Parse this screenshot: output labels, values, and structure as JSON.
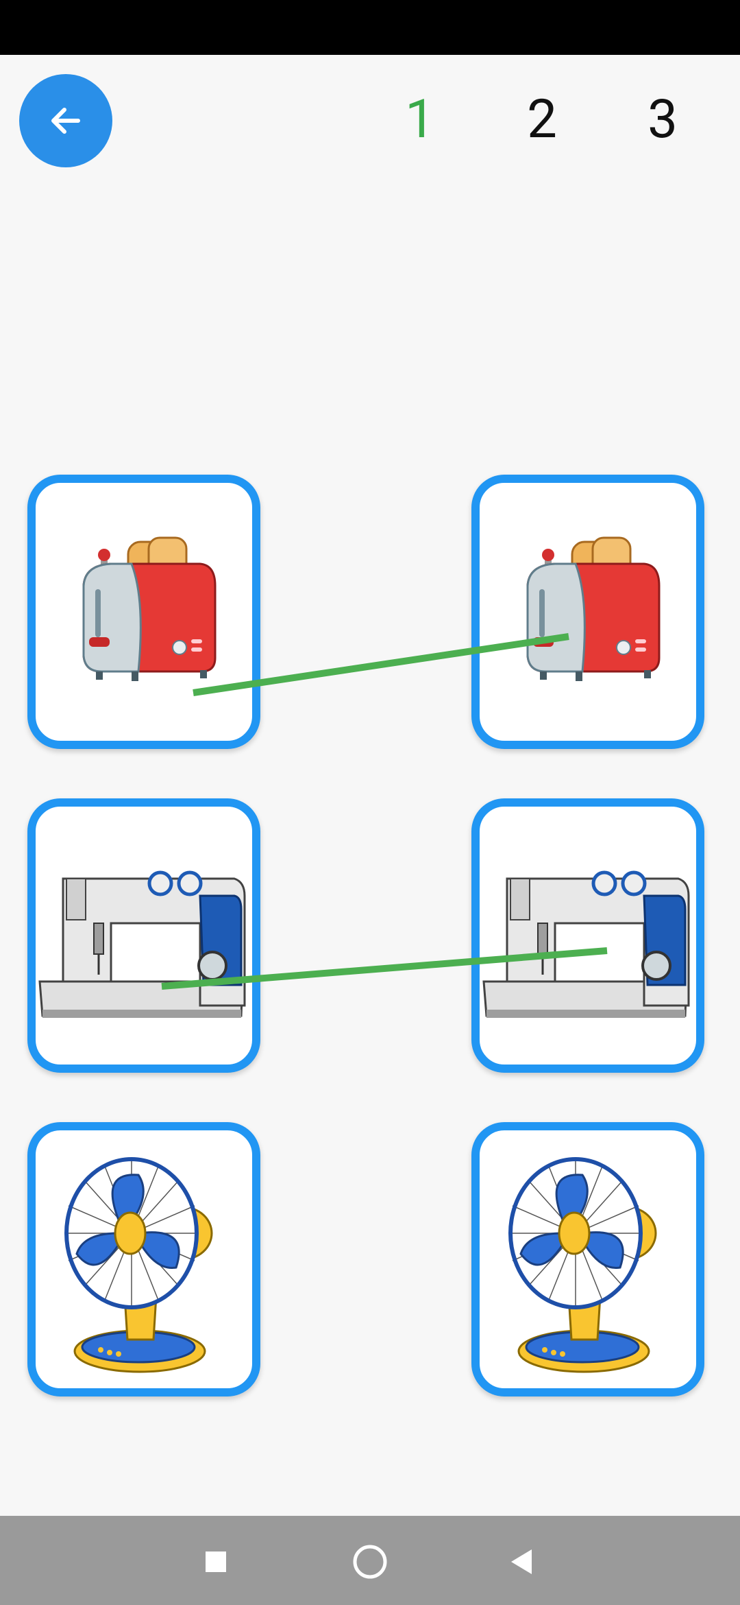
{
  "header": {
    "back_icon": "arrow-left-icon",
    "levels": [
      "1",
      "2",
      "3"
    ],
    "active_level": "1",
    "accent_color": "#2a8fe8",
    "active_level_color": "#3aaa4a"
  },
  "board": {
    "card_border_color": "#2196f3",
    "match_line_color": "#4caf50",
    "left_column": [
      {
        "item": "toaster-icon"
      },
      {
        "item": "sewing-machine-icon"
      },
      {
        "item": "electric-fan-icon"
      }
    ],
    "right_column": [
      {
        "item": "toaster-icon"
      },
      {
        "item": "sewing-machine-icon"
      },
      {
        "item": "electric-fan-icon"
      }
    ],
    "matches": [
      {
        "left": 0,
        "right": 0
      },
      {
        "left": 1,
        "right": 1
      }
    ]
  },
  "nav_bar": [
    "recents-square-icon",
    "home-circle-icon",
    "back-triangle-icon"
  ]
}
